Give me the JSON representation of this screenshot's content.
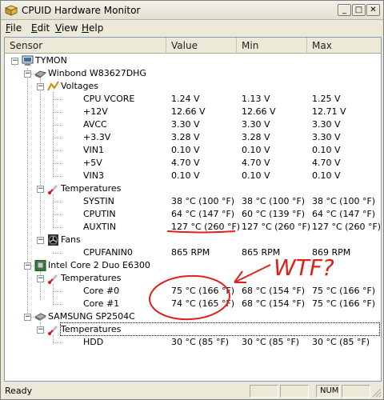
{
  "window": {
    "title": "CPUID Hardware Monitor"
  },
  "title_buttons": {
    "minimize": "_",
    "maximize": "□",
    "close": "✕"
  },
  "menu": [
    {
      "label": "File",
      "key": "F",
      "rest": "ile"
    },
    {
      "label": "Edit",
      "key": "E",
      "rest": "dit"
    },
    {
      "label": "View",
      "key": "V",
      "rest": "iew"
    },
    {
      "label": "Help",
      "key": "H",
      "rest": "elp"
    }
  ],
  "columns": {
    "sensor": "Sensor",
    "value": "Value",
    "min": "Min",
    "max": "Max"
  },
  "tree": {
    "computer": "TYMON",
    "chip1": "Winbond W83627DHG",
    "voltages": "Voltages",
    "v": [
      {
        "name": "CPU VCORE",
        "value": "1.24 V",
        "min": "1.13 V",
        "max": "1.25 V"
      },
      {
        "name": "+12V",
        "value": "12.66 V",
        "min": "12.66 V",
        "max": "12.71 V"
      },
      {
        "name": "AVCC",
        "value": "3.30 V",
        "min": "3.30 V",
        "max": "3.30 V"
      },
      {
        "name": "+3.3V",
        "value": "3.28 V",
        "min": "3.28 V",
        "max": "3.30 V"
      },
      {
        "name": "VIN1",
        "value": "0.10 V",
        "min": "0.10 V",
        "max": "0.10 V"
      },
      {
        "name": "+5V",
        "value": "4.70 V",
        "min": "4.70 V",
        "max": "4.70 V"
      },
      {
        "name": "VIN3",
        "value": "0.10 V",
        "min": "0.10 V",
        "max": "0.10 V"
      }
    ],
    "temps1": "Temperatures",
    "t1": [
      {
        "name": "SYSTIN",
        "value": "38 °C  (100 °F)",
        "min": "38 °C  (100 °F)",
        "max": "38 °C  (100 °F)"
      },
      {
        "name": "CPUTIN",
        "value": "64 °C  (147 °F)",
        "min": "60 °C  (139 °F)",
        "max": "64 °C  (147 °F)"
      },
      {
        "name": "AUXTIN",
        "value": "127 °C  (260 °F)",
        "min": "127 °C  (260 °F)",
        "max": "127 °C  (260 °F)"
      }
    ],
    "fans": "Fans",
    "f": [
      {
        "name": "CPUFANIN0",
        "value": "865 RPM",
        "min": "865 RPM",
        "max": "869 RPM"
      }
    ],
    "chip2": "Intel Core 2 Duo E6300",
    "temps2": "Temperatures",
    "t2": [
      {
        "name": "Core #0",
        "value": "75 °C  (166 °F)",
        "min": "68 °C  (154 °F)",
        "max": "75 °C  (166 °F)"
      },
      {
        "name": "Core #1",
        "value": "74 °C  (165 °F)",
        "min": "68 °C  (154 °F)",
        "max": "75 °C  (166 °F)"
      }
    ],
    "disk": "SAMSUNG SP2504C",
    "temps3": "Temperatures",
    "t3": [
      {
        "name": "HDD",
        "value": "30 °C  (85 °F)",
        "min": "30 °C  (85 °F)",
        "max": "30 °C  (85 °F)"
      }
    ]
  },
  "annotation": {
    "text": "WTF?",
    "color": "#e0201c"
  },
  "status": {
    "text": "Ready",
    "num": "NUM"
  },
  "icons": {
    "computer": "computer-icon",
    "chip": "chip-icon",
    "voltage": "voltage-icon",
    "temperature": "thermometer-icon",
    "fan": "fan-icon",
    "cpu": "cpu-icon",
    "disk": "disk-icon"
  }
}
